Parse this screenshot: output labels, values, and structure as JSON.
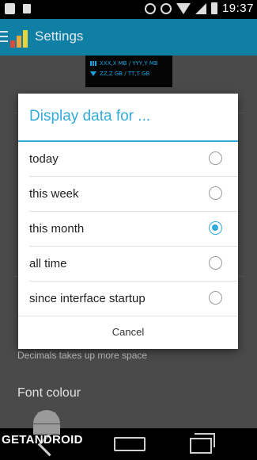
{
  "statusbar": {
    "time": "19:37",
    "icons": [
      "image-icon",
      "sd-card-icon",
      "bluetooth-icon",
      "alarm-icon",
      "wifi-icon",
      "signal-icon",
      "battery-icon"
    ]
  },
  "appbar": {
    "title": "Settings"
  },
  "widget_preview": {
    "line1": "XXX,X MB / YYY,Y MB",
    "line2": "ZZ,Z GB / TT,T GB"
  },
  "background": {
    "subtext": "Decimals takes up more space",
    "heading": "Font colour"
  },
  "dialog": {
    "title": "Display data for ...",
    "options": [
      {
        "label": "today",
        "selected": false
      },
      {
        "label": "this week",
        "selected": false
      },
      {
        "label": "this month",
        "selected": true
      },
      {
        "label": "all time",
        "selected": false
      },
      {
        "label": "since interface startup",
        "selected": false
      }
    ],
    "cancel": "Cancel"
  },
  "watermark": "GETANDROID",
  "colors": {
    "accent": "#33aad8",
    "appbar": "#0f7fa4"
  }
}
